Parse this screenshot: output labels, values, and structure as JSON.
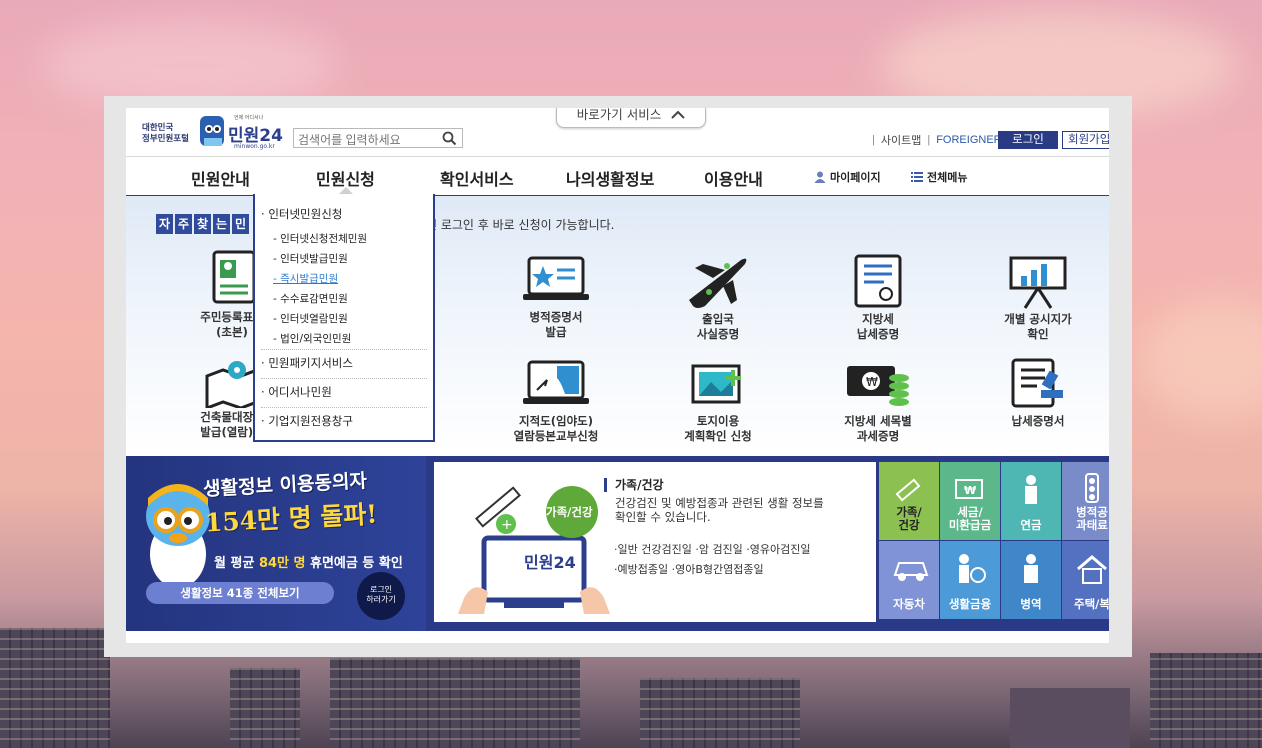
{
  "header": {
    "portal_line1": "대한민국",
    "portal_line2": "정부민원포털",
    "logo_text": "민원24",
    "logo_tagline": "언제 어디서나",
    "logo_url": "minwon.go.kr",
    "search_placeholder": "검색어를 입력하세요",
    "shortcut_tab": "바로가기 서비스",
    "sitemap": "사이트맵",
    "foreigner": "FOREIGNER",
    "login": "로그인",
    "join": "회원가입"
  },
  "gnb": {
    "items": [
      "민원안내",
      "민원신청",
      "확인서비스",
      "나의생활정보",
      "이용안내"
    ],
    "mypage": "마이페이지",
    "allmenu": "전체메뉴"
  },
  "dropdown": {
    "group1": "인터넷민원신청",
    "subs": [
      "인터넷신청전체민원",
      "인터넷발급민원",
      "즉시발급민원",
      "수수료감면민원",
      "인터넷열람민원",
      "법인/외국인민원"
    ],
    "group2": "민원패키지서비스",
    "group3": "어디서나민원",
    "group4": "기업지원전용창구"
  },
  "content": {
    "badge_chars": [
      "자",
      "주",
      "찾",
      "는",
      "민"
    ],
    "info_text": "면 로그인 후 바로 신청이 가능합니다.",
    "services": [
      {
        "line1": "주민등록표등",
        "line2": "(초본)"
      },
      {
        "line1": "병적증명서",
        "line2": "발급"
      },
      {
        "line1": "출입국",
        "line2": "사실증명"
      },
      {
        "line1": "지방세",
        "line2": "납세증명"
      },
      {
        "line1": "개별 공시지가",
        "line2": "확인"
      },
      {
        "line1": "건축물대장등",
        "line2": "발급(열람)신"
      },
      {
        "line1": "지적도(임야도)",
        "line2": "열람등본교부신청"
      },
      {
        "line1": "토지이용",
        "line2": "계획확인 신청"
      },
      {
        "line1": "지방세 세목별",
        "line2": "과세증명"
      },
      {
        "line1": "납세증명서",
        "line2": ""
      }
    ]
  },
  "banner": {
    "title_line1": "생활정보 이용동의자",
    "title_line2": "154만 명 돌파!",
    "sub_prefix": "월 평균 ",
    "sub_highlight": "84만 명",
    "sub_suffix": " 휴면예금 등 확인",
    "button": "생활정보 41종 전체보기",
    "login_line1": "로그인",
    "login_line2": "하러가기",
    "card_badge": "가족/건강",
    "card_title": "가족/건강",
    "card_desc1": "건강검진 및 예방접종과 관련된 생활 정보를",
    "card_desc2": "확인할 수 있습니다.",
    "card_tags1": "·일반 건강검진일   ·암 검진일   ·영유아검진일",
    "card_tags2": "·예방접종일   ·영아B형간염접종일"
  },
  "tiles": [
    {
      "l1": "가족/",
      "l2": "건강",
      "color": "#8cc152"
    },
    {
      "l1": "세금/",
      "l2": "미환급금",
      "color": "#5cb88a"
    },
    {
      "l1": "연금",
      "l2": "",
      "color": "#4fb7b3"
    },
    {
      "l1": "병적공",
      "l2": "과태료",
      "color": "#7a8bc9"
    },
    {
      "l1": "자동차",
      "l2": "",
      "color": "#7f93d6"
    },
    {
      "l1": "생활금융",
      "l2": "",
      "color": "#4c9bd8"
    },
    {
      "l1": "병역",
      "l2": "",
      "color": "#3f87c9"
    },
    {
      "l1": "주택/복",
      "l2": "",
      "color": "#5470c0"
    }
  ]
}
